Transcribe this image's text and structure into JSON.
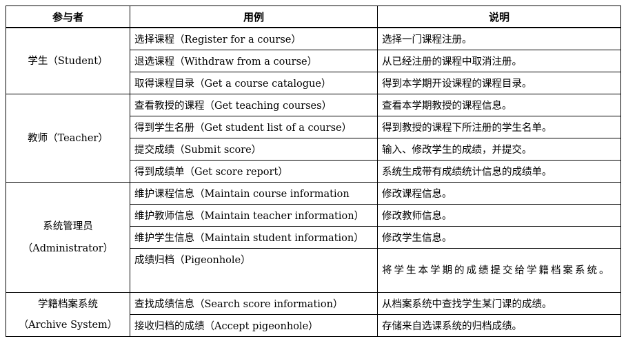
{
  "headers": {
    "actor": "参与者",
    "usecase": "用例",
    "desc": "说明"
  },
  "groups": [
    {
      "actor_cn": "学生",
      "actor_en": "（Student）",
      "rows": [
        {
          "usecase": "选择课程（Register for a course）",
          "desc": "选择一门课程注册。"
        },
        {
          "usecase": "退选课程（Withdraw from a course）",
          "desc": "从已经注册的课程中取消注册。"
        },
        {
          "usecase": "取得课程目录（Get a course catalogue）",
          "desc": "得到本学期开设课程的课程目录。"
        }
      ]
    },
    {
      "actor_cn": "教师",
      "actor_en": "（Teacher）",
      "rows": [
        {
          "usecase": "查看教授的课程（Get teaching courses）",
          "desc": "查看本学期教授的课程信息。"
        },
        {
          "usecase": "得到学生名册（Get student list of a course）",
          "desc": "得到教授的课程下所注册的学生名单。"
        },
        {
          "usecase": "提交成绩（Submit score）",
          "desc": "输入、修改学生的成绩，并提交。"
        },
        {
          "usecase": "得到成绩单（Get score report）",
          "desc": "系统生成带有成绩统计信息的成绩单。"
        }
      ]
    },
    {
      "actor_cn": "系统管理员",
      "actor_en": "（Administrator）",
      "rows": [
        {
          "usecase": "维护课程信息（Maintain course information",
          "desc": "修改课程信息。"
        },
        {
          "usecase": "维护教师信息（Maintain teacher information）",
          "desc": "修改教师信息。"
        },
        {
          "usecase": "维护学生信息（Maintain student information）",
          "desc": "修改学生信息。"
        },
        {
          "usecase": "成绩归档（Pigeonhole）",
          "desc": "将学生本学期的成绩提交给学籍档案系统。"
        }
      ]
    },
    {
      "actor_cn": "学籍档案系统",
      "actor_en": "（Archive System）",
      "rows": [
        {
          "usecase": "查找成绩信息（Search score information）",
          "desc": "从档案系统中查找学生某门课的成绩。"
        },
        {
          "usecase": "接收归档的成绩（Accept pigeonhole）",
          "desc": "存储来自选课系统的归档成绩。"
        }
      ]
    }
  ]
}
